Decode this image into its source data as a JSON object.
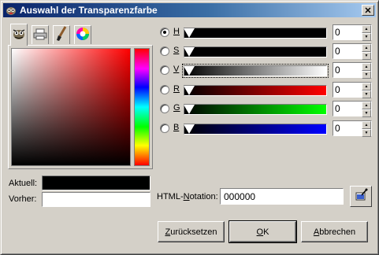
{
  "window": {
    "title": "Auswahl der Transparenzfarbe",
    "close_glyph": "✕"
  },
  "tabs": [
    {
      "name": "gimp-icon",
      "active": true
    },
    {
      "name": "printer-icon",
      "active": false
    },
    {
      "name": "brush-icon",
      "active": false
    },
    {
      "name": "color-wheel-icon",
      "active": false
    }
  ],
  "colors": {
    "current": "#000000",
    "previous": "#ffffff",
    "accent": "#0a246a"
  },
  "labels": {
    "current": "Aktuell:",
    "previous": "Vorher:",
    "html_notation_prefix": "HTML-",
    "html_notation_mnemonic": "N",
    "html_notation_rest": "otation:"
  },
  "channels": [
    {
      "key": "h",
      "label": "H",
      "value": "0",
      "selected": true
    },
    {
      "key": "s",
      "label": "S",
      "value": "0",
      "selected": false
    },
    {
      "key": "v",
      "label": "V",
      "value": "0",
      "selected": false
    },
    {
      "key": "r",
      "label": "R",
      "value": "0",
      "selected": false
    },
    {
      "key": "g",
      "label": "G",
      "value": "0",
      "selected": false
    },
    {
      "key": "b",
      "label": "B",
      "value": "0",
      "selected": false
    }
  ],
  "html_value": "000000",
  "buttons": {
    "reset": {
      "mnemonic": "Z",
      "rest": "urücksetzen"
    },
    "ok": {
      "mnemonic": "O",
      "rest": "K"
    },
    "cancel": {
      "mnemonic": "A",
      "rest": "bbrechen"
    }
  },
  "spin": {
    "up": "▲",
    "down": "▼"
  }
}
